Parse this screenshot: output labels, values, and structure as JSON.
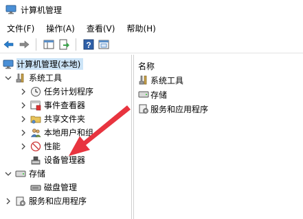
{
  "window": {
    "title": "计算机管理"
  },
  "menu": [
    "文件(F)",
    "操作(A)",
    "查看(V)",
    "帮助(H)"
  ],
  "toolbar": [
    "back-icon",
    "forward-icon",
    "show-hide-tree-icon",
    "export-list-icon",
    "help-icon",
    "properties-icon"
  ],
  "tree": {
    "root": "计算机管理(本地)",
    "system_tools": "系统工具",
    "task_scheduler": "任务计划程序",
    "event_viewer": "事件查看器",
    "shared_folders": "共享文件夹",
    "local_users": "本地用户和组",
    "performance": "性能",
    "device_manager": "设备管理器",
    "storage": "存储",
    "disk_management": "磁盘管理",
    "services_apps": "服务和应用程序"
  },
  "list": {
    "header": "名称",
    "items": [
      "系统工具",
      "存储",
      "服务和应用程序"
    ]
  },
  "colors": {
    "accent_arrow": "#e8343f",
    "selection": "#cce4f7"
  }
}
